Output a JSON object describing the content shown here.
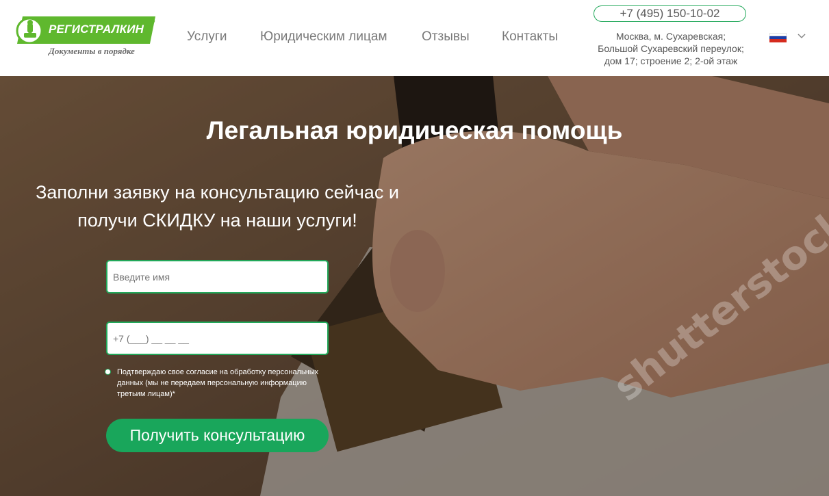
{
  "brand": {
    "name": "РЕГИСТРАЛКИН",
    "registered_mark": "®",
    "tagline": "Документы в порядке",
    "color": "#5fb82e"
  },
  "nav": {
    "items": [
      {
        "label": "Услуги"
      },
      {
        "label": "Юридическим лицам"
      },
      {
        "label": "Отзывы"
      },
      {
        "label": "Контакты"
      }
    ]
  },
  "contact": {
    "phone": "+7 (495) 150-10-02",
    "address_line1": "Москва, м. Сухаревская;",
    "address_line2": "Большой Сухаревский переулок;",
    "address_line3": "дом 17; строение 2; 2-ой этаж"
  },
  "language": {
    "icon": "russia-flag-icon",
    "dropdown_icon": "chevron-down-icon"
  },
  "hero": {
    "title": "Легальная юридическая помощь",
    "subtitle_line1": "Заполни заявку на консультацию сейчас и",
    "subtitle_line2": "получи СКИДКУ на наши услуги!",
    "watermark": "shutterstock"
  },
  "form": {
    "name_placeholder": "Введите имя",
    "phone_placeholder": "+7 (___) __ __ __",
    "consent_text": "Подтверждаю свое согласие на обработку персональных данных (мы не передаем персональную информацию третьим лицам)*",
    "submit_label": "Получить консультацию"
  },
  "colors": {
    "accent": "#19a65b",
    "border": "#22a85a"
  }
}
